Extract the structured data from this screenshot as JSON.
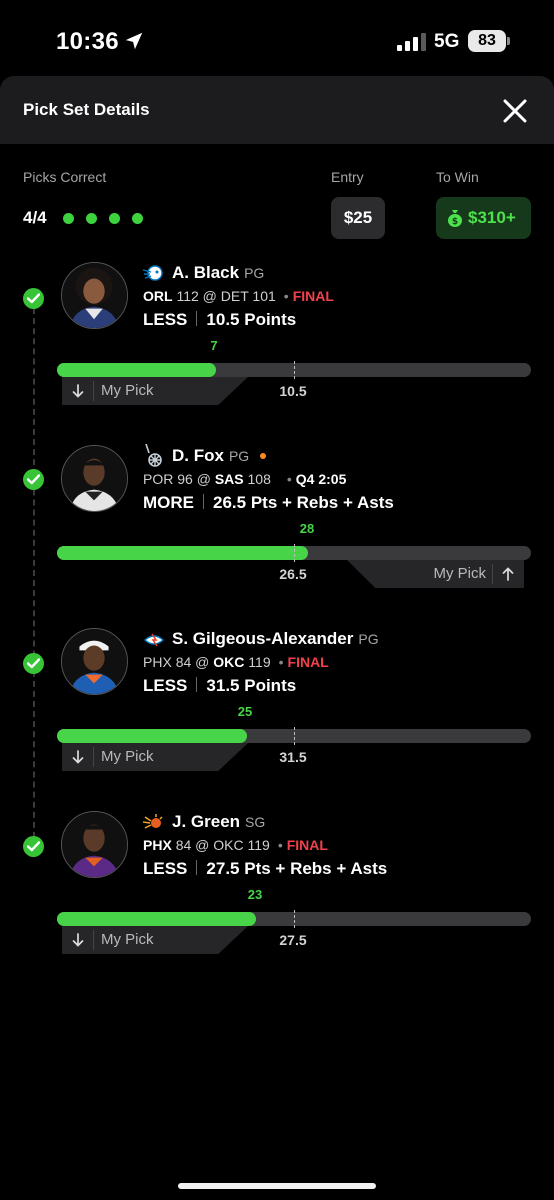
{
  "status_bar": {
    "time": "10:36",
    "network": "5G",
    "battery": "83"
  },
  "sheet": {
    "title": "Pick Set Details",
    "picks_correct_label": "Picks Correct",
    "picks_correct_value": "4/4",
    "entry_label": "Entry",
    "entry_value": "$25",
    "to_win_label": "To Win",
    "to_win_value": "$310+"
  },
  "colors": {
    "accent_green": "#48d448",
    "final_red": "#f0414c",
    "live_orange": "#ff8a1e"
  },
  "picks": [
    {
      "name": "A. Black",
      "position": "PG",
      "team_icon": "magic-logo-icon",
      "away_team": "ORL",
      "away_score": "112",
      "at": "@",
      "home_team": "DET",
      "home_score": "101",
      "status": "FINAL",
      "direction": "LESS",
      "line": "10.5",
      "stat": "Points",
      "actual": "7",
      "my_pick": "My Pick",
      "actual_fraction": 0.335,
      "line_fraction": 0.5
    },
    {
      "name": "D. Fox",
      "position": "PG",
      "team_icon": "spurs-logo-icon",
      "away_team": "POR",
      "away_score": "96",
      "at": "@",
      "home_team": "SAS",
      "home_score": "108",
      "status": "Q4 2:05",
      "direction": "MORE",
      "line": "26.5",
      "stat": "Pts + Rebs + Asts",
      "actual": "28",
      "my_pick": "My Pick",
      "actual_fraction": 0.53,
      "line_fraction": 0.5
    },
    {
      "name": "S. Gilgeous-Alexander",
      "position": "PG",
      "team_icon": "thunder-logo-icon",
      "away_team": "PHX",
      "away_score": "84",
      "at": "@",
      "home_team": "OKC",
      "home_score": "119",
      "status": "FINAL",
      "direction": "LESS",
      "line": "31.5",
      "stat": "Points",
      "actual": "25",
      "my_pick": "My Pick",
      "actual_fraction": 0.4,
      "line_fraction": 0.5
    },
    {
      "name": "J. Green",
      "position": "SG",
      "team_icon": "suns-logo-icon",
      "away_team": "PHX",
      "away_score": "84",
      "at": "@",
      "home_team": "OKC",
      "home_score": "119",
      "status": "FINAL",
      "direction": "LESS",
      "line": "27.5",
      "stat": "Pts + Rebs + Asts",
      "actual": "23",
      "my_pick": "My Pick",
      "actual_fraction": 0.42,
      "line_fraction": 0.5
    }
  ]
}
